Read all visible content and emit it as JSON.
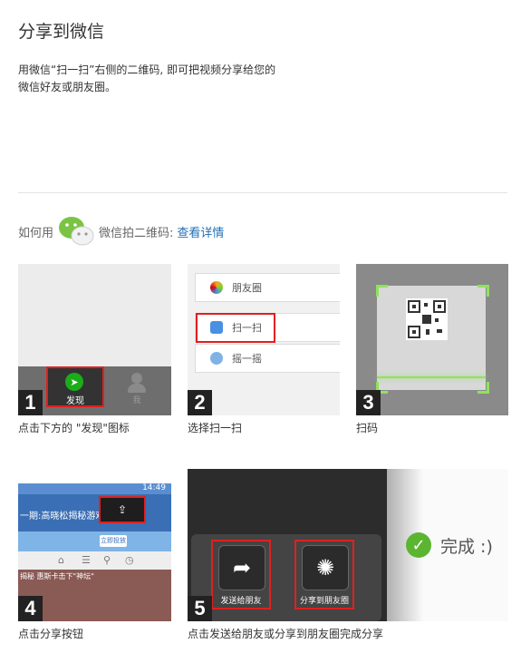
{
  "header": {
    "title": "分享到微信",
    "desc_line1": "用微信“扫一扫”右侧的二维码, 即可把视频分享给您的",
    "desc_line2": "微信好友或朋友圈。"
  },
  "howto": {
    "prefix": "如何用",
    "middle": "微信拍二维码:",
    "link": "查看详情"
  },
  "steps": [
    {
      "num": "1",
      "caption": "点击下方的 \"发现\"图标",
      "tab_find": "发现",
      "tab_me": "我"
    },
    {
      "num": "2",
      "caption": "选择扫一扫",
      "rows": [
        "朋友圈",
        "扫一扫",
        "摇一摇"
      ]
    },
    {
      "num": "3",
      "caption": "扫码"
    },
    {
      "num": "4",
      "caption": "点击分享按钮",
      "status_time": "14:49",
      "bar_title": "一期:高晓松揭秘游戏 ...",
      "ad_button": "立即投放",
      "video_text": "揭秘 惠斯卡击下\"神坛\""
    },
    {
      "num": "5",
      "caption": "点击发送给朋友或分享到朋友圈完成分享",
      "send_label": "发送给朋友",
      "moments_label": "分享到朋友圈",
      "done_label": "完成 :)"
    }
  ],
  "colors": {
    "wechat_green": "#1aad19",
    "highlight_red": "#e02020",
    "link_blue": "#1f6fb8"
  }
}
